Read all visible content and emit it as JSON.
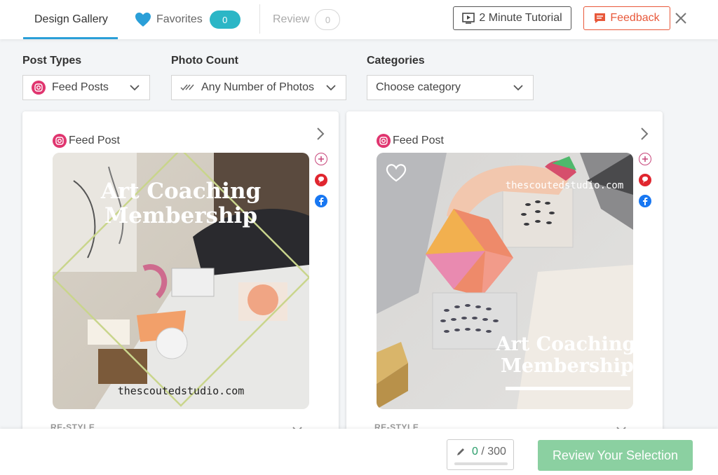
{
  "tabs": {
    "gallery": "Design Gallery",
    "favorites": "Favorites",
    "favorites_count": "0",
    "review": "Review",
    "review_count": "0"
  },
  "header": {
    "tutorial_label": "2 Minute Tutorial",
    "feedback_label": "Feedback"
  },
  "filters": {
    "post_types_label": "Post Types",
    "post_types_value": "Feed Posts",
    "photo_count_label": "Photo Count",
    "photo_count_value": "Any Number of Photos",
    "categories_label": "Categories",
    "categories_value": "Choose category"
  },
  "cards": [
    {
      "type": "Feed Post",
      "title_line1": "Art Coaching",
      "title_line2": "Membership",
      "website": "thescoutedstudio.com",
      "restyle": "RE-STYLE"
    },
    {
      "type": "Feed Post",
      "title_line1": "Art Coaching",
      "title_line2": "Membership",
      "website": "thescoutedstudio.com",
      "restyle": "RE-STYLE"
    }
  ],
  "footer": {
    "count": "0",
    "total": "/ 300",
    "progress": 0,
    "review_button": "Review Your Selection"
  },
  "colors": {
    "accent_blue": "#2a9fd8",
    "teal": "#2bb6c6",
    "feedback_red": "#e8583a",
    "green": "#8bd0a1"
  },
  "icons": [
    "heart-icon",
    "tutorial-icon",
    "feedback-icon",
    "close-icon",
    "instagram-icon",
    "checkmarks-icon",
    "chevron-down-icon",
    "chevron-right-icon",
    "add-icon",
    "pinterest-icon",
    "facebook-icon",
    "pencil-icon"
  ]
}
